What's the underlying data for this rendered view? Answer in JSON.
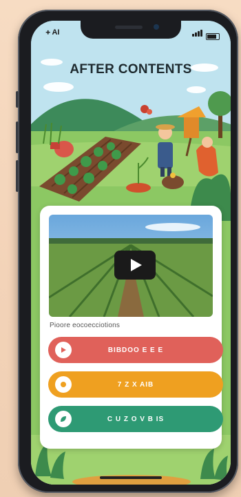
{
  "status_bar": {
    "carrier": "ᚐ AI"
  },
  "header": {
    "title": "AFTER CONTENTS"
  },
  "video": {
    "caption": "Pioore eocoecciotions"
  },
  "actions": [
    {
      "label": "BIBDOO E E E",
      "icon": "play-icon",
      "color": "#e0615a"
    },
    {
      "label": "7 Z X AIB",
      "icon": "circle-icon",
      "color": "#efa020"
    },
    {
      "label": "C U Z O V B IS",
      "icon": "leaf-icon",
      "color": "#2e9a74"
    }
  ],
  "colors": {
    "sky": "#bfe3ef",
    "grass": "#8cc863",
    "soil": "#7a4a2e",
    "phone": "#1b1c20"
  }
}
